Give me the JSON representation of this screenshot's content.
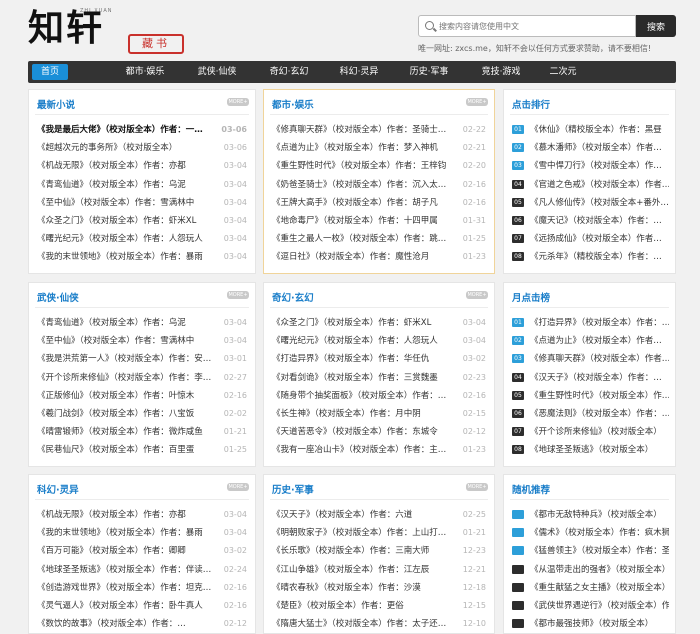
{
  "logo": {
    "main": "知轩",
    "seal": "藏书",
    "small": "ZHI XUAN"
  },
  "search": {
    "placeholder": "搜索内容请您使用中文",
    "button": "搜索"
  },
  "notice": "唯一网址: zxcs.me，知轩不会以任何方式要求赞助，请不要相信!",
  "nav": [
    "首页",
    "都市·娱乐",
    "武侠·仙侠",
    "奇幻·玄幻",
    "科幻·灵异",
    "历史·军事",
    "竞技·游戏",
    "二次元"
  ],
  "more": "MORE+",
  "boxes": [
    {
      "title": "最新小说",
      "items": [
        {
          "t": "《我是最后大佬》（校对版全本）作者：一…",
          "d": "03-06"
        },
        {
          "t": "《超越次元的事务所》（校对版全本）",
          "d": "03-06"
        },
        {
          "t": "《机战无限》（校对版全本）作者：亦都",
          "d": "03-04"
        },
        {
          "t": "《青鸾仙道》（校对版全本）作者：乌泥",
          "d": "03-04"
        },
        {
          "t": "《至中仙》（校对版全本）作者：雪满林中",
          "d": "03-04"
        },
        {
          "t": "《众圣之门》（校对版全本）作者：虾米XL",
          "d": "03-04"
        },
        {
          "t": "《曙光纪元》（校对版全本）作者：人怨玩人",
          "d": "03-04"
        },
        {
          "t": "《我的末世领地》（校对版全本）作者：暴雨",
          "d": "03-04"
        }
      ]
    },
    {
      "title": "都市·娱乐",
      "items": [
        {
          "t": "《修真聊天群》（校对版全本）作者：圣骑士…",
          "d": "02-22"
        },
        {
          "t": "《点道为止》（校对版全本）作者：梦入神机",
          "d": "02-21"
        },
        {
          "t": "《重生野性时代》（校对版全本）作者：王梓钧",
          "d": "02-20"
        },
        {
          "t": "《奶爸圣骑士》（校对版全本）作者：沉入太…",
          "d": "02-16"
        },
        {
          "t": "《王牌大高手》（校对版全本）作者：胡子凡",
          "d": "02-16"
        },
        {
          "t": "《地命毒尸》（校对版全本）作者：十四甲属",
          "d": "01-31"
        },
        {
          "t": "《重生之最人一枚》（校对版全本）作者：跳…",
          "d": "01-25"
        },
        {
          "t": "《逗日社》（校对版全本）作者：魔性沧月",
          "d": "01-23"
        }
      ]
    },
    {
      "title": "点击排行",
      "rank": true,
      "items": [
        {
          "n": "01",
          "t": "《休仙》（精校版全本）作者：黑昼"
        },
        {
          "n": "02",
          "t": "《慕木潘师》（校对版全本）作者…"
        },
        {
          "n": "03",
          "t": "《雪中悍刀行》（校对版全本）作…"
        },
        {
          "n": "04",
          "t": "《官道之色戒》（校对版全本）作者…"
        },
        {
          "n": "05",
          "t": "《凡人修仙传》（校对版全本+番外…"
        },
        {
          "n": "06",
          "t": "《魔天记》（校对版全本）作者：…"
        },
        {
          "n": "07",
          "t": "《远扬成仙》（校对版全本）作者…"
        },
        {
          "n": "08",
          "t": "《元杀年》（精校版全本）作者：…"
        }
      ]
    },
    {
      "title": "武侠·仙侠",
      "items": [
        {
          "t": "《青鸾仙道》（校对版全本）作者：乌泥",
          "d": "03-04"
        },
        {
          "t": "《至中仙》（校对版全本）作者：雪满林中",
          "d": "03-04"
        },
        {
          "t": "《我是洪荒第一人》（校对版全本）作者：安…",
          "d": "03-01"
        },
        {
          "t": "《开个诊所来修仙》（校对版全本）作者：李…",
          "d": "02-27"
        },
        {
          "t": "《正版修仙》（校对版全本）作者：叶惊木",
          "d": "02-16"
        },
        {
          "t": "《羲门战剑》（校对版全本）作者：八宝饭",
          "d": "02-02"
        },
        {
          "t": "《晴雷锻师》（校对版全本）作者：微炸咸鱼",
          "d": "01-21"
        },
        {
          "t": "《民巷仙尺》（校对版全本）作者：百里蛋",
          "d": "01-25"
        }
      ]
    },
    {
      "title": "奇幻·玄幻",
      "items": [
        {
          "t": "《众圣之门》（校对版全本）作者：虾米XL",
          "d": "03-04"
        },
        {
          "t": "《曙光纪元》（校对版全本）作者：人怨玩人",
          "d": "03-04"
        },
        {
          "t": "《打造异界》（校对版全本）作者：华任仇",
          "d": "03-02"
        },
        {
          "t": "《对看剑诡》（校对版全本）作者：三赏魏墨",
          "d": "02-23"
        },
        {
          "t": "《随身带个抽奖面板》（校对版全本）作者：…",
          "d": "02-16"
        },
        {
          "t": "《长生神》（校对版全本）作者：月中阴",
          "d": "02-15"
        },
        {
          "t": "《天道苦恶令》（校对版全本）作者：东城令",
          "d": "02-12"
        },
        {
          "t": "《我有一座冶山卡》（校对版全本）作者：主…",
          "d": "01-23"
        }
      ]
    },
    {
      "title": "月点击榜",
      "rank": true,
      "items": [
        {
          "n": "01",
          "t": "《打造异界》（校对版全本）作者：…"
        },
        {
          "n": "02",
          "t": "《点道为止》（校对版全本）作者…"
        },
        {
          "n": "03",
          "t": "《修真聊天群》（校对版全本）作者…"
        },
        {
          "n": "04",
          "t": "《汉天子》（校对版全本）作者：…"
        },
        {
          "n": "05",
          "t": "《重生野性时代》（校对版全本）作…"
        },
        {
          "n": "06",
          "t": "《恶魔法则》（校对版全本）作者：…"
        },
        {
          "n": "07",
          "t": "《开个诊所来修仙》（校对版全本）"
        },
        {
          "n": "08",
          "t": "《地球圣圣叛逃》（校对版全本）"
        }
      ]
    },
    {
      "title": "科幻·灵异",
      "items": [
        {
          "t": "《机战无限》（校对版全本）作者：亦都",
          "d": "03-04"
        },
        {
          "t": "《我的末世领地》（校对版全本）作者：暴雨",
          "d": "03-04"
        },
        {
          "t": "《百万可能》（校对版全本）作者：卿卿",
          "d": "03-02"
        },
        {
          "t": "《地球圣圣叛逃》（校对版全本）作者：伴读…",
          "d": "02-24"
        },
        {
          "t": "《创造游戏世界》（校对版全本）作者：坦克…",
          "d": "02-16"
        },
        {
          "t": "《灵气逼人》（校对版全本）作者：卧牛真人",
          "d": "02-16"
        },
        {
          "t": "《数饮的故事》（校对版全本）作者：…",
          "d": "02-12"
        }
      ]
    },
    {
      "title": "历史·军事",
      "items": [
        {
          "t": "《汉天子》（校对版全本）作者：六道",
          "d": "02-25"
        },
        {
          "t": "《明朝败家子》（校对版全本）作者：上山打…",
          "d": "01-21"
        },
        {
          "t": "《长乐歌》（校对版全本）作者：三南大师",
          "d": "12-23"
        },
        {
          "t": "《江山争雄》（校对版全本）作者：江左辰",
          "d": "12-21"
        },
        {
          "t": "《晴农春秋》（校对版全本）作者：沙漠",
          "d": "12-18"
        },
        {
          "t": "《楚臣》（校对版全本）作者：更俗",
          "d": "12-15"
        },
        {
          "t": "《隋唐大猛士》（校对版全本）作者：太子还…",
          "d": "12-10"
        }
      ]
    },
    {
      "title": "随机推荐",
      "rank": true,
      "items": [
        {
          "n": "",
          "t": "《都市无敌特种兵》（校对版全本）"
        },
        {
          "n": "",
          "t": "《儒术》（校对版全本）作者：疯木狮"
        },
        {
          "n": "",
          "t": "《猛兽领主》（校对版全本）作者：圣"
        },
        {
          "n": "",
          "t": "《从温带走出的强者》（校对版全本）"
        },
        {
          "n": "",
          "t": "《重生献猛之女主播》（校对版全本）"
        },
        {
          "n": "",
          "t": "《武侠世界遇逆行》（校对版全本）作"
        },
        {
          "n": "",
          "t": "《都市最强技师》（校对版全本）"
        }
      ]
    }
  ]
}
